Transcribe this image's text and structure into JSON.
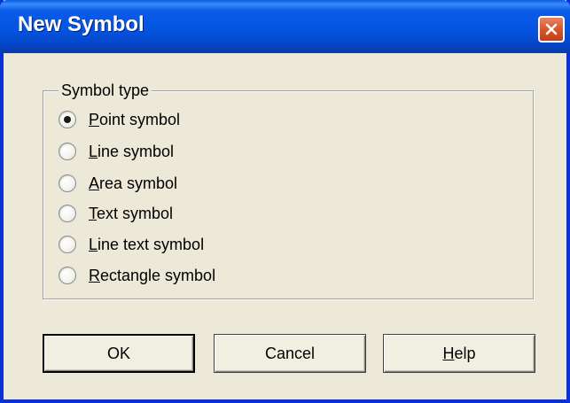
{
  "window": {
    "title": "New Symbol"
  },
  "group": {
    "legend": "Symbol type",
    "options": [
      {
        "prefix": "",
        "accel": "P",
        "rest": "oint symbol",
        "checked": true
      },
      {
        "prefix": "",
        "accel": "L",
        "rest": "ine symbol",
        "checked": false
      },
      {
        "prefix": "",
        "accel": "A",
        "rest": "rea symbol",
        "checked": false
      },
      {
        "prefix": "",
        "accel": "T",
        "rest": "ext symbol",
        "checked": false
      },
      {
        "prefix": "",
        "accel": "L",
        "rest": "ine text symbol",
        "checked": false
      },
      {
        "prefix": "",
        "accel": "R",
        "rest": "ectangle symbol",
        "checked": false
      }
    ]
  },
  "buttons": {
    "ok_label": "OK",
    "cancel_label": "Cancel",
    "help_accel": "H",
    "help_rest": "elp"
  },
  "colors": {
    "titlebar": "#0a5ce8",
    "close_button": "#d9562a",
    "dialog_background": "#ece9d8"
  },
  "icons": {
    "close": "close-icon"
  }
}
